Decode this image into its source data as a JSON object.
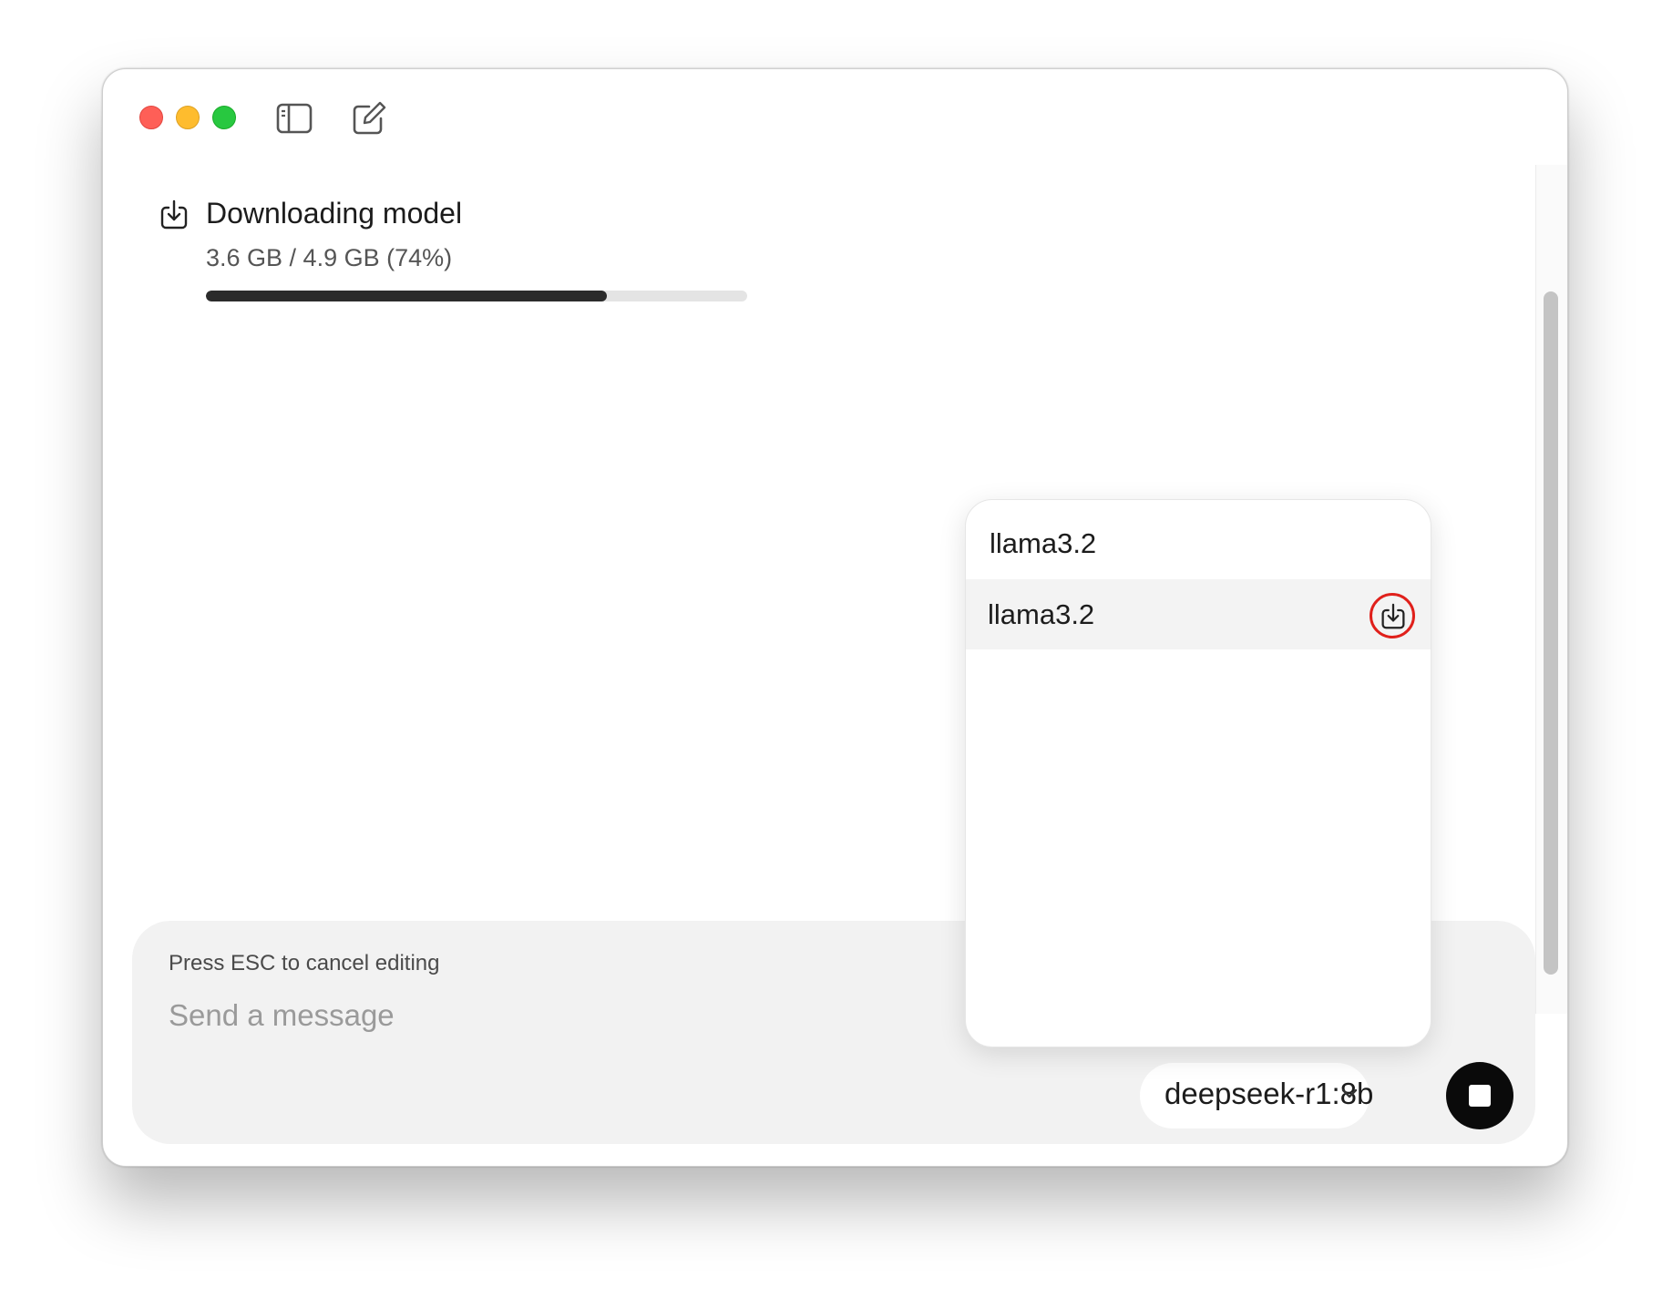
{
  "titlebar": {
    "controls": [
      "close",
      "minimize",
      "maximize"
    ],
    "icons": [
      "sidebar-toggle-icon",
      "new-chat-icon"
    ]
  },
  "download": {
    "icon": "download-icon",
    "title": "Downloading model",
    "progress_text": "3.6 GB / 4.9 GB (74%)",
    "progress_fraction": 0.74
  },
  "composer": {
    "hint": "Press ESC to cancel editing",
    "placeholder": "Send a message",
    "model_label": "deepseek-r1:8b",
    "stop_icon": "stop-icon"
  },
  "model_picker": {
    "search_value": "llama3.2",
    "items": [
      {
        "label": "llama3.2",
        "icon": "download-icon",
        "highlighted": true
      }
    ]
  },
  "colors": {
    "accent_ring": "#e0201b",
    "progress_fill": "#2b2b2b",
    "stop_button": "#0a0a0a"
  }
}
